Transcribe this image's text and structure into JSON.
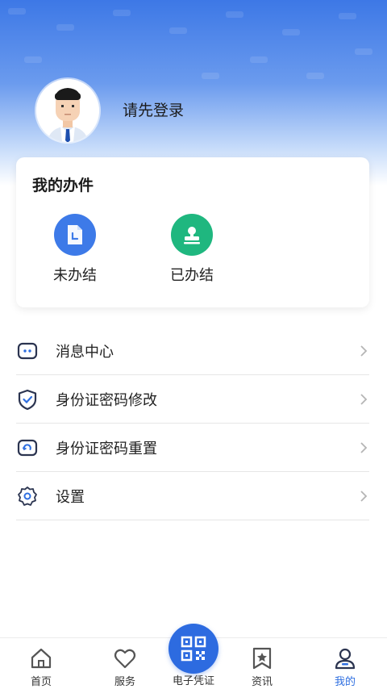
{
  "profile": {
    "login_prompt": "请先登录"
  },
  "my_tasks": {
    "title": "我的办件",
    "items": [
      {
        "label": "未办结",
        "icon": "document-clock-icon",
        "color": "#3d7ae8"
      },
      {
        "label": "已办结",
        "icon": "stamp-icon",
        "color": "#1fb77f"
      }
    ]
  },
  "menu": {
    "items": [
      {
        "label": "消息中心",
        "icon": "message-icon"
      },
      {
        "label": "身份证密码修改",
        "icon": "shield-check-icon"
      },
      {
        "label": "身份证密码重置",
        "icon": "reset-icon"
      },
      {
        "label": "设置",
        "icon": "gear-icon"
      }
    ]
  },
  "tabbar": {
    "items": [
      {
        "label": "首页",
        "icon": "home-icon"
      },
      {
        "label": "服务",
        "icon": "heart-icon"
      },
      {
        "label": "电子凭证",
        "icon": "qr-code-icon"
      },
      {
        "label": "资讯",
        "icon": "bookmark-star-icon"
      },
      {
        "label": "我的",
        "icon": "user-icon",
        "active": true
      }
    ]
  },
  "colors": {
    "accent": "#2f6fe0",
    "hero_top": "#3d78e6",
    "completed_green": "#1fb77f"
  }
}
